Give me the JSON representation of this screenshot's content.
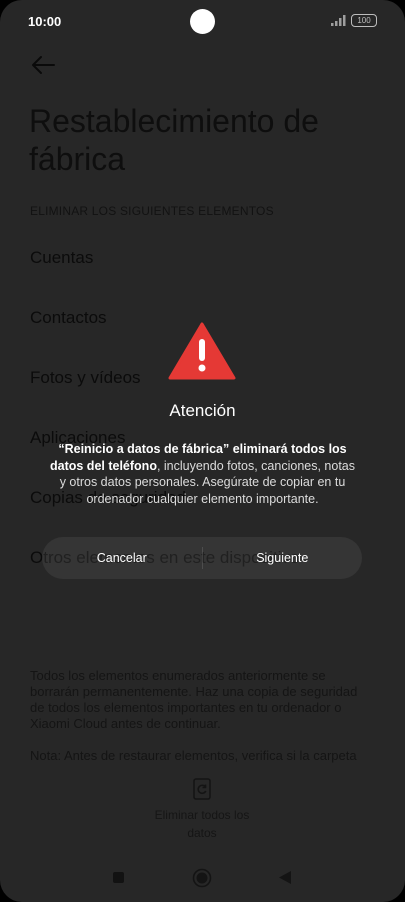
{
  "status_bar": {
    "time": "10:00",
    "battery": "100"
  },
  "page": {
    "title": "Restablecimiento de fábrica",
    "section_header": "ELIMINAR LOS SIGUIENTES ELEMENTOS",
    "items": [
      {
        "label": "Cuentas"
      },
      {
        "label": "Contactos"
      },
      {
        "label": "Fotos y vídeos"
      },
      {
        "label": "Aplicaciones"
      },
      {
        "label": "Copias de seguridad"
      },
      {
        "label": "Otros elementos en este dispositivo"
      }
    ],
    "footer_text_1": "Todos los elementos enumerados anteriormente se borrarán permanentemente. Haz una copia de seguridad de todos los elementos importantes en tu ordenador o Xiaomi Cloud antes de continuar.",
    "footer_text_2": "Nota: Antes de restaurar elementos, verifica si la carpeta",
    "erase_label": "Eliminar todos los datos"
  },
  "dialog": {
    "title": "Atención",
    "message_bold": "“Reinicio a datos de fábrica” eliminará todos los datos del teléfono",
    "message_rest": ", incluyendo fotos, canciones, notas y otros datos personales. Asegúrate de copiar en tu ordenador cualquier elemento importante.",
    "cancel_label": "Cancelar",
    "next_label": "Siguiente",
    "warning_color": "#e53935"
  },
  "icons": {
    "back": "arrow-left-icon",
    "warning": "warning-triangle-icon",
    "erase": "phone-reset-icon",
    "nav_recents": "square-icon",
    "nav_home": "circle-icon",
    "nav_back": "triangle-back-icon"
  }
}
